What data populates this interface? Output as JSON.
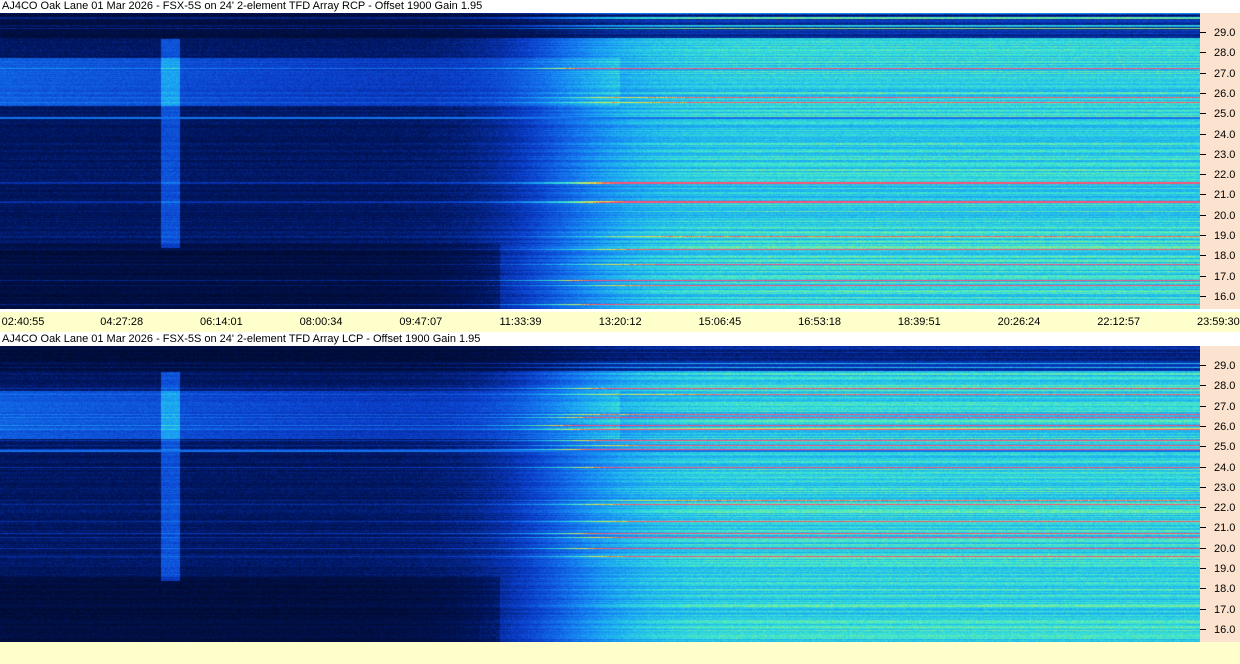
{
  "panels": [
    {
      "title": "AJ4CO Oak Lane 01 Mar 2026 - FSX-5S on 24' 2-element TFD Array RCP  -  Offset 1900  Gain 1.95",
      "polarization": "RCP"
    },
    {
      "title": "AJ4CO Oak Lane 01 Mar 2026 - FSX-5S on 24' 2-element TFD Array LCP  -  Offset 1900  Gain 1.95",
      "polarization": "LCP"
    }
  ],
  "freq_axis": {
    "labels": [
      "29.0",
      "28.0",
      "27.0",
      "26.0",
      "25.0",
      "24.0",
      "23.0",
      "22.0",
      "21.0",
      "20.0",
      "19.0",
      "18.0",
      "17.0",
      "16.0"
    ]
  },
  "time_axis": {
    "labels": [
      "02:40:55",
      "04:27:28",
      "06:14:01",
      "08:00:34",
      "09:47:07",
      "11:33:39",
      "13:20:12",
      "15:06:45",
      "16:53:18",
      "18:39:51",
      "20:26:24",
      "22:12:57",
      "23:59:30"
    ]
  },
  "colors": {
    "background": "#000814",
    "axis_freq_bg": "#fbe3cf",
    "axis_time_bg": "#ffffcc"
  }
}
